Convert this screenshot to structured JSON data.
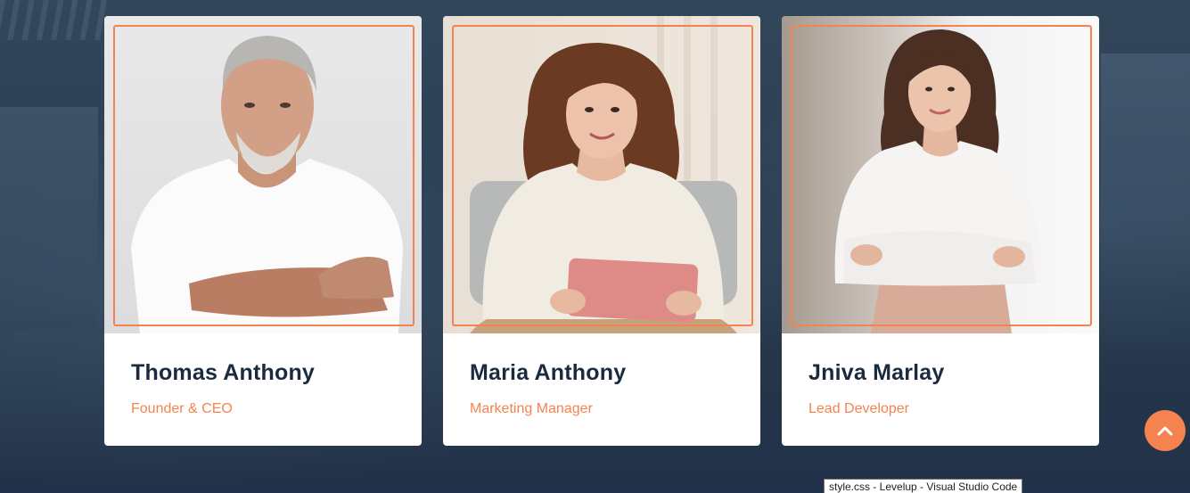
{
  "team": [
    {
      "name": "Thomas Anthony",
      "role": "Founder & CEO"
    },
    {
      "name": "Maria Anthony",
      "role": "Marketing Manager"
    },
    {
      "name": "Jniva Marlay",
      "role": "Lead Developer"
    }
  ],
  "scroll_top": {
    "icon": "chevron-up-icon"
  },
  "taskbar_tooltip": "style.css - Levelup - Visual Studio Code",
  "colors": {
    "accent": "#f5834f",
    "heading": "#1b2b3e",
    "card": "#ffffff",
    "background": "#2a3c50"
  }
}
